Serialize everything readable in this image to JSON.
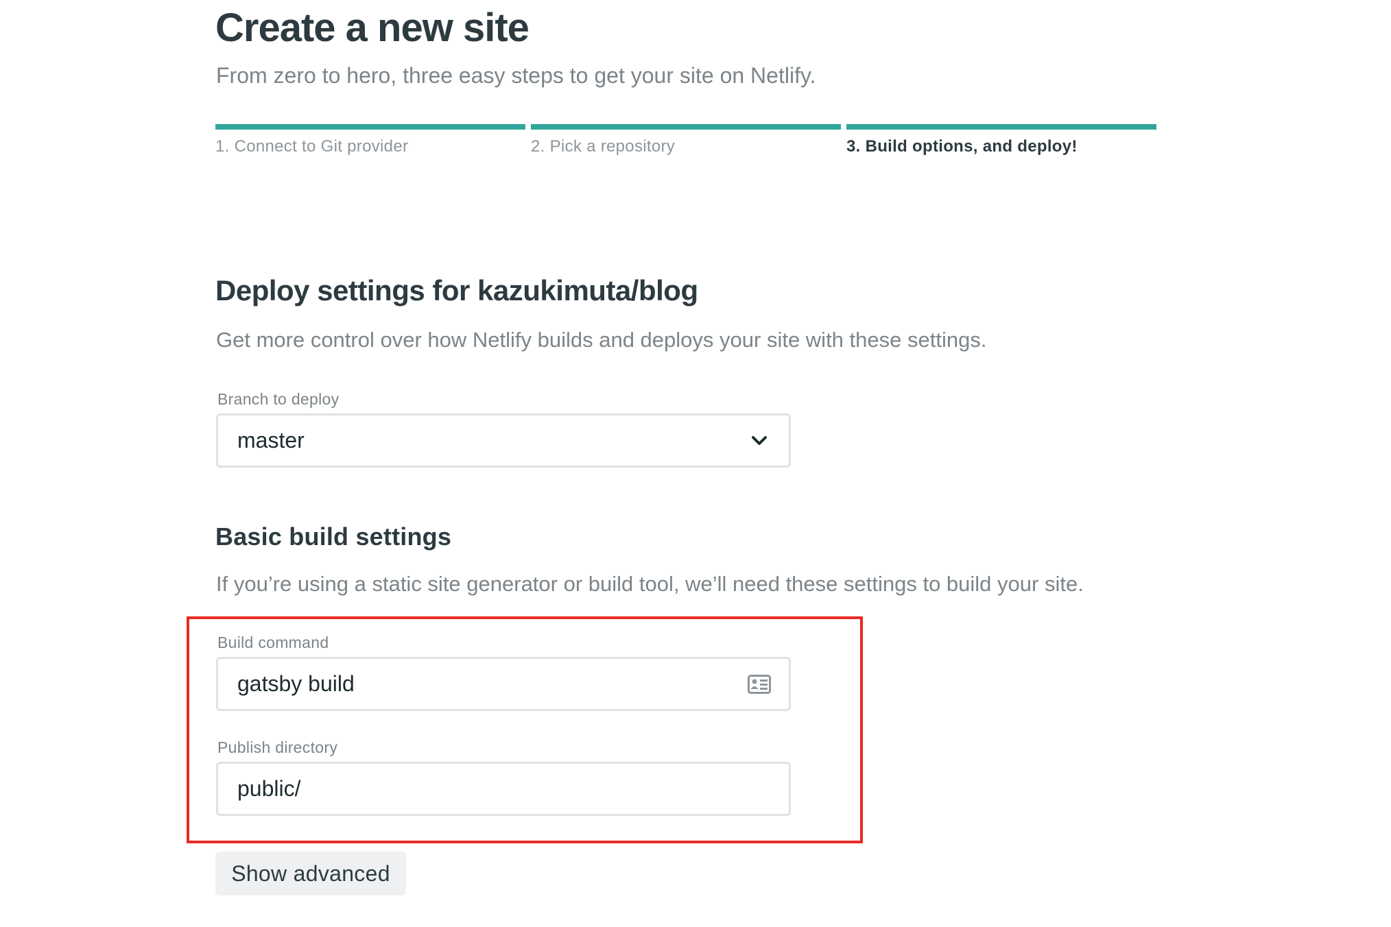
{
  "header": {
    "title": "Create a new site",
    "subtitle": "From zero to hero, three easy steps to get your site on Netlify."
  },
  "steps": [
    {
      "label": "1. Connect to Git provider",
      "active": false
    },
    {
      "label": "2. Pick a repository",
      "active": false
    },
    {
      "label": "3. Build options, and deploy!",
      "active": true
    }
  ],
  "deploy": {
    "title": "Deploy settings for kazukimuta/blog",
    "description": "Get more control over how Netlify builds and deploys your site with these settings.",
    "branch_label": "Branch to deploy",
    "branch_value": "master"
  },
  "basic_build": {
    "title": "Basic build settings",
    "description": "If you’re using a static site generator or build tool, we’ll need these settings to build your site.",
    "build_command_label": "Build command",
    "build_command_value": "gatsby build",
    "publish_dir_label": "Publish directory",
    "publish_dir_value": "public/"
  },
  "actions": {
    "show_advanced": "Show advanced"
  },
  "colors": {
    "accent": "#30a59b",
    "highlight": "#ea2a22",
    "text": "#2d3b41",
    "muted": "#7c8489"
  },
  "icons": {
    "branch_select": "chevron-down-icon",
    "build_command": "contact-card-icon"
  }
}
